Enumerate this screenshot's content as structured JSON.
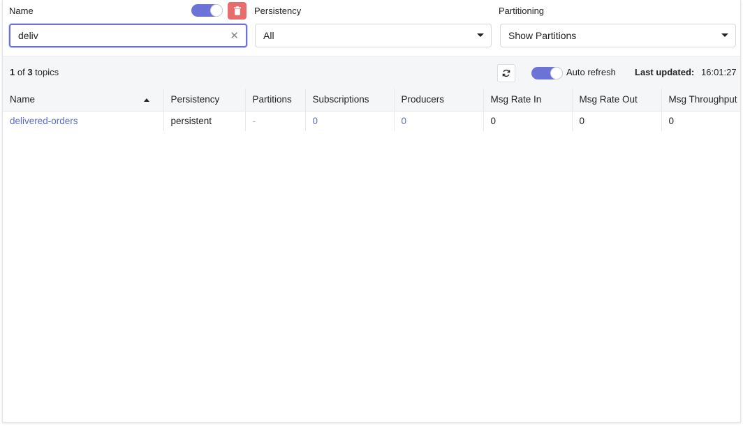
{
  "filters": {
    "name": {
      "label": "Name",
      "value": "deliv",
      "placeholder": ""
    },
    "persistency": {
      "label": "Persistency",
      "selected": "All"
    },
    "partitioning": {
      "label": "Partitioning",
      "selected": "Show Partitions"
    }
  },
  "summary": {
    "shown": "1",
    "of_text": " of ",
    "total": "3",
    "unit": " topics",
    "auto_refresh_label": "Auto refresh",
    "last_updated_label": "Last updated:",
    "last_updated_time": "16:01:27"
  },
  "table": {
    "columns": [
      "Name",
      "Persistency",
      "Partitions",
      "Subscriptions",
      "Producers",
      "Msg Rate In",
      "Msg Rate Out",
      "Msg Throughput"
    ],
    "sorted_column": "Name",
    "sort_direction": "ascending",
    "rows": [
      {
        "name": "delivered-orders",
        "persistency": "persistent",
        "partitions": "-",
        "subscriptions": "0",
        "producers": "0",
        "msg_rate_in": "0",
        "msg_rate_out": "0",
        "msg_throughput": "0"
      }
    ]
  },
  "colors": {
    "accent": "#6b74d6",
    "link": "#5d6bc9",
    "danger": "#e86c6c"
  },
  "icons": {
    "delete": "trash-icon",
    "clear": "close-icon",
    "refresh": "refresh-icon",
    "dropdown": "caret-down-icon",
    "sort": "sort-asc-icon"
  }
}
